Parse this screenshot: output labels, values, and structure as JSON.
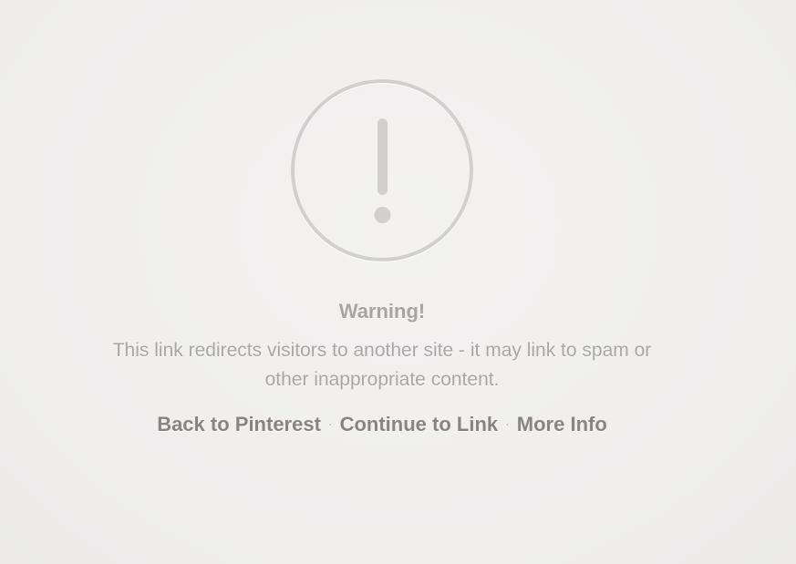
{
  "warning": {
    "icon": "exclamation-circle-icon",
    "title": "Warning!",
    "message": "This link redirects visitors to another site - it may link to spam or other inappropriate content."
  },
  "actions": {
    "back_label": "Back to Pinterest",
    "continue_label": "Continue to Link",
    "more_info_label": "More Info",
    "separator": "·"
  },
  "colors": {
    "background": "#f1f0ef",
    "icon_stroke": "#d2d0cf",
    "text_muted": "#a9a6a6",
    "link_text": "#8a8383"
  }
}
